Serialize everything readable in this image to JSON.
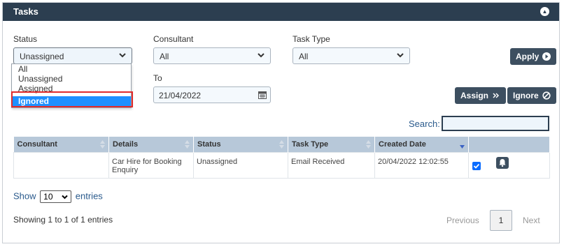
{
  "panel": {
    "title": "Tasks"
  },
  "filters": {
    "status_label": "Status",
    "status_value": "Unassigned",
    "status_options": [
      "All",
      "Unassigned",
      "Assigned",
      "Ignored"
    ],
    "status_highlighted": "Ignored",
    "consultant_label": "Consultant",
    "consultant_value": "All",
    "task_type_label": "Task Type",
    "task_type_value": "All",
    "to_label": "To",
    "to_value": "21/04/2022"
  },
  "buttons": {
    "apply": "Apply",
    "assign": "Assign",
    "ignore": "Ignore"
  },
  "search": {
    "label": "Search:",
    "value": ""
  },
  "table": {
    "headers": [
      "Consultant",
      "Details",
      "Status",
      "Task Type",
      "Created Date",
      ""
    ],
    "rows": [
      {
        "consultant": "",
        "details": "Car Hire for Booking Enquiry",
        "status": "Unassigned",
        "task_type": "Email Received",
        "created_date": "20/04/2022 12:02:55",
        "checked": true
      }
    ]
  },
  "length": {
    "show": "Show",
    "value": "10",
    "entries": "entries"
  },
  "info": "Showing 1 to 1 of 1 entries",
  "pagination": {
    "previous": "Previous",
    "current": "1",
    "next": "Next"
  },
  "colors": {
    "header_bg": "#2c3e50",
    "button_bg": "#3d4f60",
    "th_bg": "#b7c8d9",
    "selection": "#1e90ff",
    "highlight": "#e02b2b"
  }
}
